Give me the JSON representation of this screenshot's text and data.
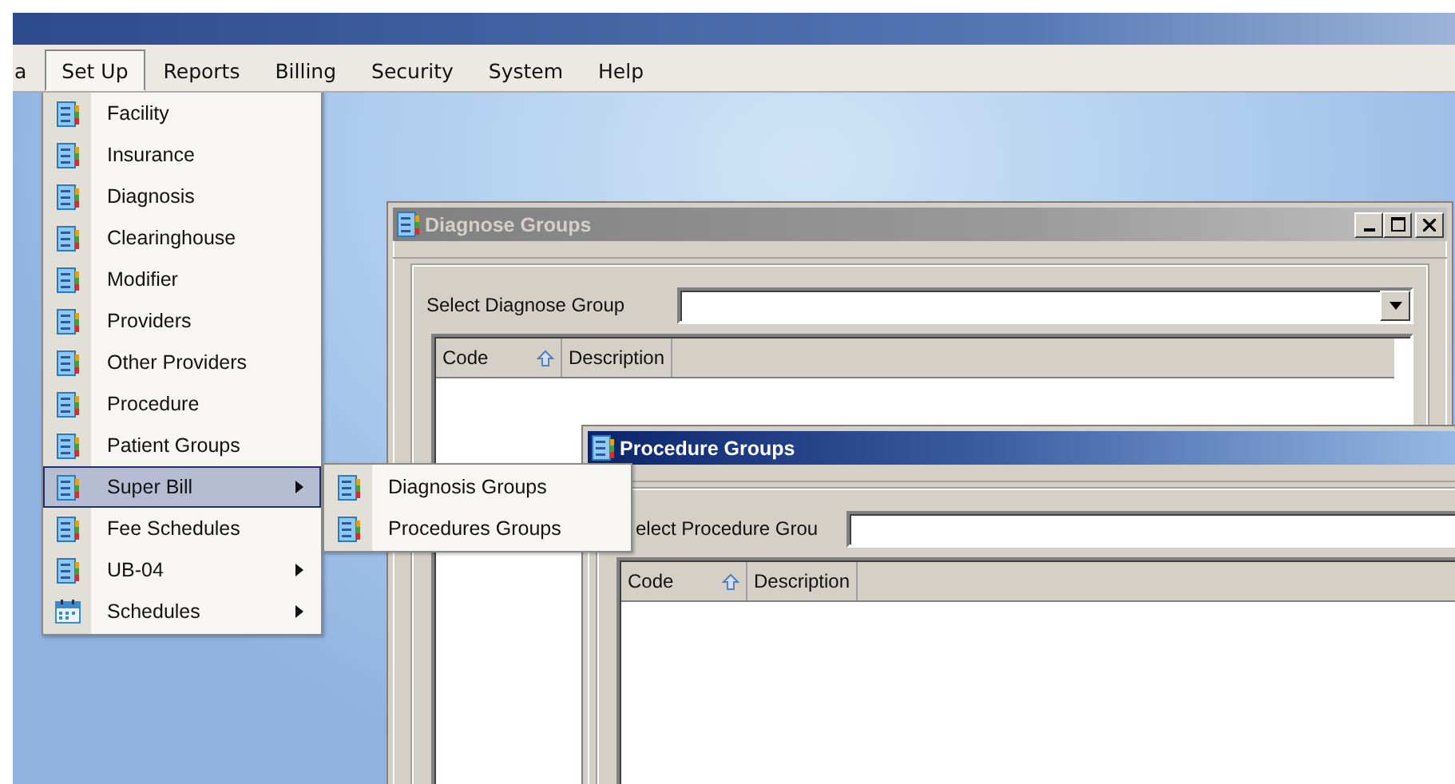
{
  "menu_bar": [
    {
      "label": "a",
      "selected": false
    },
    {
      "label": "Set Up",
      "selected": true
    },
    {
      "label": "Reports",
      "selected": false
    },
    {
      "label": "Billing",
      "selected": false
    },
    {
      "label": "Security",
      "selected": false
    },
    {
      "label": "System",
      "selected": false
    },
    {
      "label": "Help",
      "selected": false
    }
  ],
  "setup_menu": {
    "items": [
      {
        "label": "Facility",
        "kind": "document",
        "has_submenu": false,
        "selected": false
      },
      {
        "label": "Insurance",
        "kind": "document",
        "has_submenu": false,
        "selected": false
      },
      {
        "label": "Diagnosis",
        "kind": "document",
        "has_submenu": false,
        "selected": false
      },
      {
        "label": "Clearinghouse",
        "kind": "document",
        "has_submenu": false,
        "selected": false
      },
      {
        "label": "Modifier",
        "kind": "document",
        "has_submenu": false,
        "selected": false
      },
      {
        "label": "Providers",
        "kind": "document",
        "has_submenu": false,
        "selected": false
      },
      {
        "label": "Other Providers",
        "kind": "document",
        "has_submenu": false,
        "selected": false
      },
      {
        "label": "Procedure",
        "kind": "document",
        "has_submenu": false,
        "selected": false
      },
      {
        "label": "Patient Groups",
        "kind": "document",
        "has_submenu": false,
        "selected": false
      },
      {
        "label": "Super Bill",
        "kind": "document",
        "has_submenu": true,
        "selected": true
      },
      {
        "label": "Fee Schedules",
        "kind": "document",
        "has_submenu": false,
        "selected": false
      },
      {
        "label": "UB-04",
        "kind": "document",
        "has_submenu": true,
        "selected": false
      },
      {
        "label": "Schedules",
        "kind": "calendar",
        "has_submenu": true,
        "selected": false
      }
    ]
  },
  "super_bill_submenu": {
    "items": [
      {
        "label": "Diagnosis Groups",
        "kind": "document",
        "has_submenu": false,
        "selected": false
      },
      {
        "label": "Procedures Groups",
        "kind": "document",
        "has_submenu": false,
        "selected": false
      }
    ]
  },
  "windows": [
    {
      "title": "Diagnose Groups",
      "active": false,
      "select_label": "Select  Diagnose Group",
      "columns": [
        {
          "label": "Code",
          "sorted": true
        },
        {
          "label": "Description",
          "sorted": false
        }
      ]
    },
    {
      "title": "Procedure Groups",
      "active": true,
      "select_label": "elect  Procedure Grou",
      "columns": [
        {
          "label": "Code",
          "sorted": true
        },
        {
          "label": "Description",
          "sorted": false
        }
      ]
    }
  ]
}
